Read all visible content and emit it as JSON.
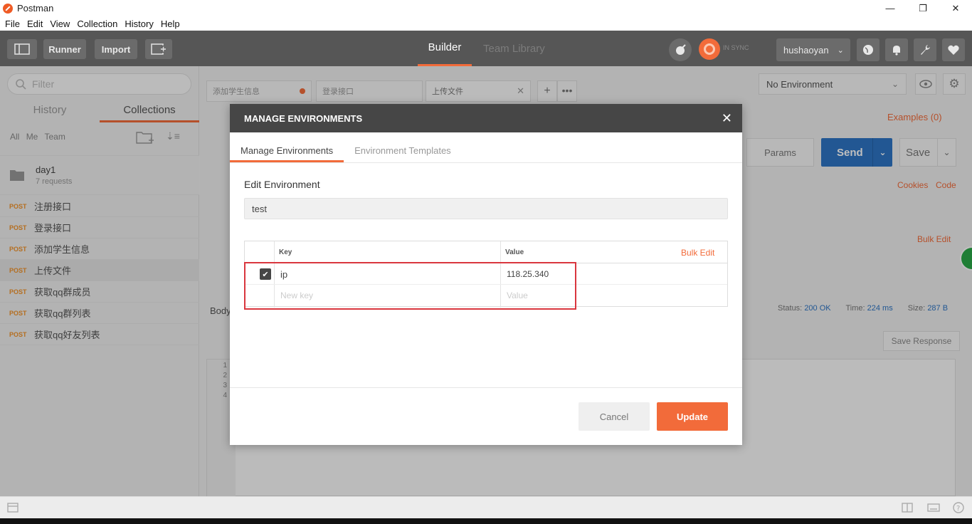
{
  "window": {
    "title": "Postman",
    "minimize": "—",
    "restore": "❐",
    "close": "✕"
  },
  "menu": [
    "File",
    "Edit",
    "View",
    "Collection",
    "History",
    "Help"
  ],
  "toolbar": {
    "runner": "Runner",
    "import": "Import",
    "tabs": [
      "Builder",
      "Team Library"
    ],
    "sync": "IN SYNC",
    "user": "hushaoyan"
  },
  "sidebar": {
    "filter_placeholder": "Filter",
    "tabs": [
      "History",
      "Collections"
    ],
    "filters": [
      "All",
      "Me",
      "Team"
    ],
    "collection": {
      "name": "day1",
      "count": "7 requests"
    },
    "requests": [
      {
        "method": "POST",
        "name": "注册接口"
      },
      {
        "method": "POST",
        "name": "登录接口"
      },
      {
        "method": "POST",
        "name": "添加学生信息"
      },
      {
        "method": "POST",
        "name": "上传文件"
      },
      {
        "method": "POST",
        "name": "获取qq群成员"
      },
      {
        "method": "POST",
        "name": "获取qq群列表"
      },
      {
        "method": "POST",
        "name": "获取qq好友列表"
      }
    ]
  },
  "main": {
    "request_tabs": [
      "添加学生信息",
      "登录接口",
      "上传文件"
    ],
    "environment": "No Environment",
    "examples": "Examples (0)",
    "params": "Params",
    "send": "Send",
    "save": "Save",
    "cookies": "Cookies",
    "code": "Code",
    "bulk_edit": "Bulk Edit",
    "body": "Body",
    "status_label": "Status:",
    "status_value": "200 OK",
    "time_label": "Time:",
    "time_value": "224 ms",
    "size_label": "Size:",
    "size_value": "287 B",
    "save_response": "Save Response",
    "line_numbers": [
      "1",
      "2",
      "3",
      "4"
    ]
  },
  "modal": {
    "title": "MANAGE ENVIRONMENTS",
    "close": "✕",
    "tabs": [
      "Manage Environments",
      "Environment Templates"
    ],
    "edit_label": "Edit Environment",
    "env_name": "test",
    "table": {
      "key_header": "Key",
      "value_header": "Value",
      "bulk_edit": "Bulk Edit",
      "rows": [
        {
          "checked": true,
          "key": "ip",
          "value": "118.25.340"
        }
      ],
      "new_key_placeholder": "New key",
      "new_value_placeholder": "Value"
    },
    "cancel": "Cancel",
    "update": "Update"
  },
  "colors": {
    "accent": "#f26b3a",
    "send": "#2e75c4",
    "toolbar": "#565656",
    "highlight": "#d9363e"
  }
}
